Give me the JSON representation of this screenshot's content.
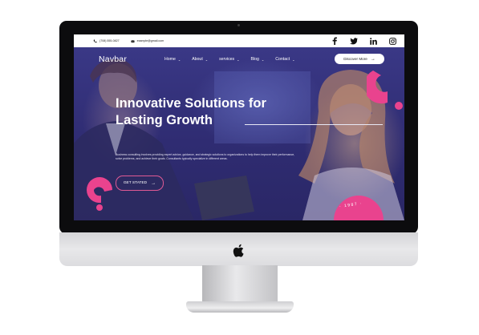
{
  "topbar": {
    "phone": "(708) 555-0827",
    "email": "example@gmail.com",
    "socials": [
      "facebook-icon",
      "twitter-icon",
      "linkedin-icon",
      "instagram-icon"
    ]
  },
  "navbar": {
    "brand": "Navbar",
    "items": [
      {
        "label": "Home"
      },
      {
        "label": "About"
      },
      {
        "label": "services"
      },
      {
        "label": "Blog"
      },
      {
        "label": "Contact"
      }
    ],
    "cta_label": "Discover More"
  },
  "hero": {
    "title_line1": "Innovative Solutions for",
    "title_line2": "Lasting Growth",
    "description": "Business consulting involves providing expert advice, guidance, and strategic solutions to organizations to help them improve their performance, solve problems, and achieve their goals. Consultants typically specialize in different areas.",
    "button_label": "GET STATED",
    "badge_text": "· 1987 ·"
  },
  "colors": {
    "accent": "#e9438e",
    "overlay": "#3b3583",
    "frame": "#0c0c0e"
  }
}
